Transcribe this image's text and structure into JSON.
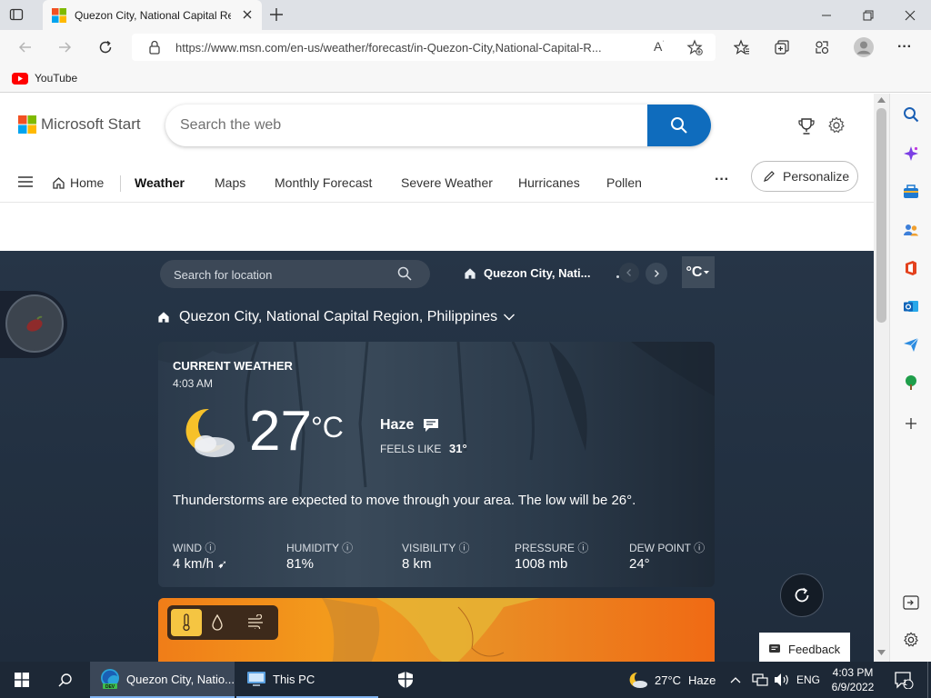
{
  "browser": {
    "tab_title": "Quezon City, National Capital Re",
    "url": "https://www.msn.com/en-us/weather/forecast/in-Quezon-City,National-Capital-R...",
    "favorites": [
      {
        "label": "YouTube"
      }
    ]
  },
  "msn": {
    "brand": "Microsoft Start",
    "search_placeholder": "Search the web",
    "nav": [
      "Home",
      "Weather",
      "Maps",
      "Monthly Forecast",
      "Severe Weather",
      "Hurricanes",
      "Pollen"
    ],
    "more": "···",
    "personalize": "Personalize"
  },
  "weather": {
    "location_search_placeholder": "Search for location",
    "saved_location": "Quezon City, Nati...",
    "unit": "°C",
    "location_full": "Quezon City, National Capital Region, Philippines",
    "card": {
      "heading": "CURRENT WEATHER",
      "time": "4:03 AM",
      "temp": "27",
      "temp_unit": "°C",
      "condition": "Haze",
      "feels_like_label": "FEELS LIKE",
      "feels_like_value": "31°",
      "summary": "Thunderstorms are expected to move through your area. The low will be 26°.",
      "stats": [
        {
          "label": "WIND",
          "value": "4 km/h"
        },
        {
          "label": "HUMIDITY",
          "value": "81%"
        },
        {
          "label": "VISIBILITY",
          "value": "8 km"
        },
        {
          "label": "PRESSURE",
          "value": "1008 mb"
        },
        {
          "label": "DEW POINT",
          "value": "24°"
        }
      ]
    },
    "feedback": "Feedback"
  },
  "taskbar": {
    "apps": [
      {
        "label": "Quezon City, Natio..."
      },
      {
        "label": "This PC"
      }
    ],
    "weather_temp": "27°C",
    "weather_cond": "Haze",
    "lang": "ENG",
    "time": "4:03 PM",
    "date": "6/9/2022",
    "notification_count": "1"
  },
  "colors": {
    "accent": "#0f6cbd",
    "weather_bg": "#233142",
    "taskbar": "#1d2836"
  }
}
